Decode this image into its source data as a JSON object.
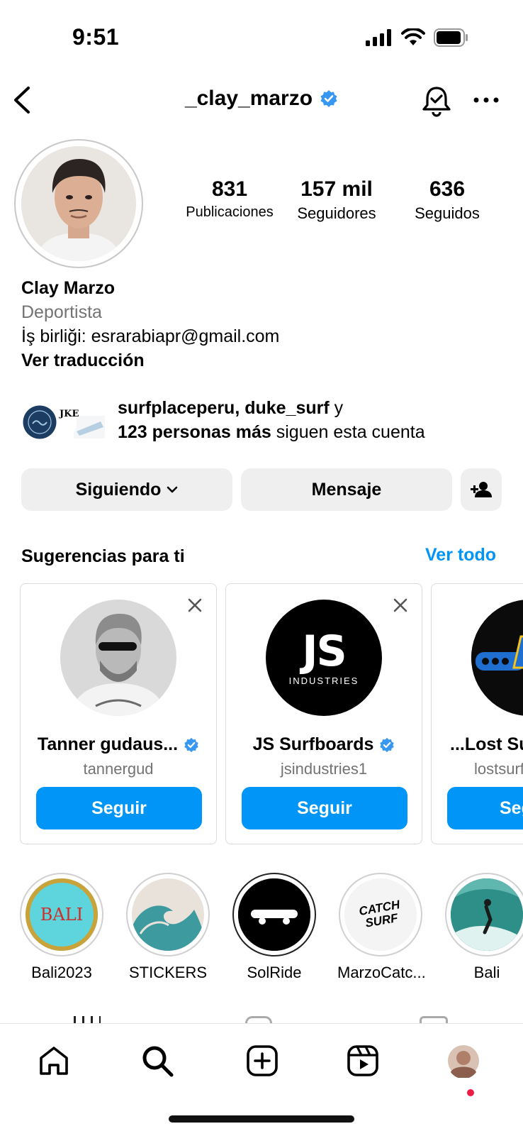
{
  "status_bar": {
    "time": "9:51"
  },
  "header": {
    "username": "_clay_marzo"
  },
  "stats": [
    {
      "value": "831",
      "label": "Publicaciones"
    },
    {
      "value": "157 mil",
      "label": "Seguidores"
    },
    {
      "value": "636",
      "label": "Seguidos"
    }
  ],
  "bio": {
    "name": "Clay Marzo",
    "category": "Deportista",
    "line": "İş birliği: esrarabiapr@gmail.com",
    "translate": "Ver traducción"
  },
  "followed_by": {
    "names": "surfplaceperu, duke_surf",
    "connector": " y",
    "others": "123 personas más",
    "suffix": " siguen esta cuenta",
    "mini_logo_text": "JKE"
  },
  "actions": {
    "following": "Siguiendo",
    "message": "Mensaje"
  },
  "suggestions": {
    "title": "Sugerencias para ti",
    "see_all": "Ver todo",
    "cards": [
      {
        "name": "Tanner gudaus...",
        "handle": "tannergud",
        "button": "Seguir",
        "verified": true
      },
      {
        "name": "JS Surfboards",
        "handle": "jsindustries1",
        "button": "Seguir",
        "verified": true,
        "logo_main": "JS",
        "logo_sub": "INDUSTRIES"
      },
      {
        "name": "...Lost Surfb",
        "handle": "lostsurfboards",
        "button": "Seguir",
        "verified": false
      }
    ]
  },
  "highlights": [
    {
      "label": "Bali2023",
      "cover_text": "BALI"
    },
    {
      "label": "STICKERS"
    },
    {
      "label": "SolRide"
    },
    {
      "label": "MarzoCatc...",
      "cover_text": "CATCH SURF"
    },
    {
      "label": "Bali"
    }
  ],
  "colors": {
    "accent": "#0095f6",
    "verified": "#3897f0",
    "notification_dot": "#ed1c45"
  },
  "tabbar_icons": [
    "home-icon",
    "search-icon",
    "create-icon",
    "reels-icon",
    "profile-avatar"
  ]
}
